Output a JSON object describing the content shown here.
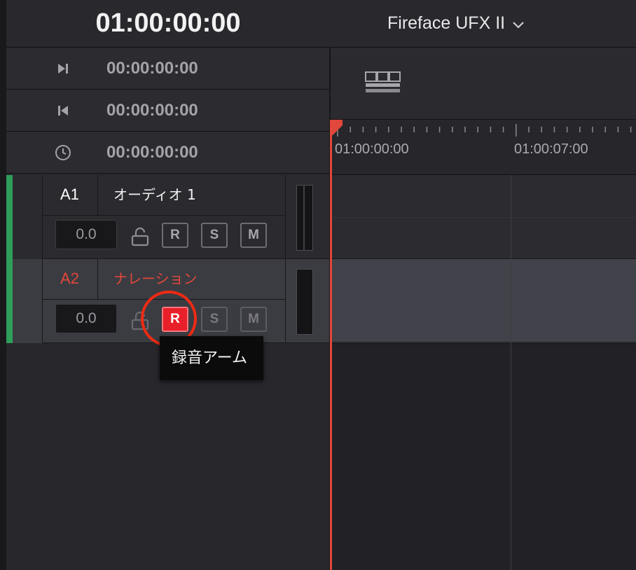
{
  "header": {
    "master_timecode": "01:00:00:00",
    "audio_device": "Fireface UFX II",
    "device_chevron_icon": "chevron-down-icon"
  },
  "timecodes": [
    {
      "icon": "mark-out-icon",
      "value": "00:00:00:00"
    },
    {
      "icon": "mark-in-icon",
      "value": "00:00:00:00"
    },
    {
      "icon": "clock-icon",
      "value": "00:00:00:00"
    }
  ],
  "tracks": [
    {
      "id": "A1",
      "name": "オーディオ 1",
      "volume": "0.0",
      "record_label": "R",
      "solo_label": "S",
      "mute_label": "M",
      "armed": false,
      "color": "#ffffff"
    },
    {
      "id": "A2",
      "name": "ナレーション",
      "volume": "0.0",
      "record_label": "R",
      "solo_label": "S",
      "mute_label": "M",
      "armed": true,
      "color": "#e2473b"
    }
  ],
  "ruler": {
    "labels": [
      "01:00:00:00",
      "01:00:07:00"
    ]
  },
  "tooltip": {
    "text": "録音アーム"
  },
  "colors": {
    "accent_red": "#e2473b",
    "record_arm_red": "#e8202a",
    "track_green": "#2e9e5b",
    "highlight_ring": "#ee2a13"
  }
}
